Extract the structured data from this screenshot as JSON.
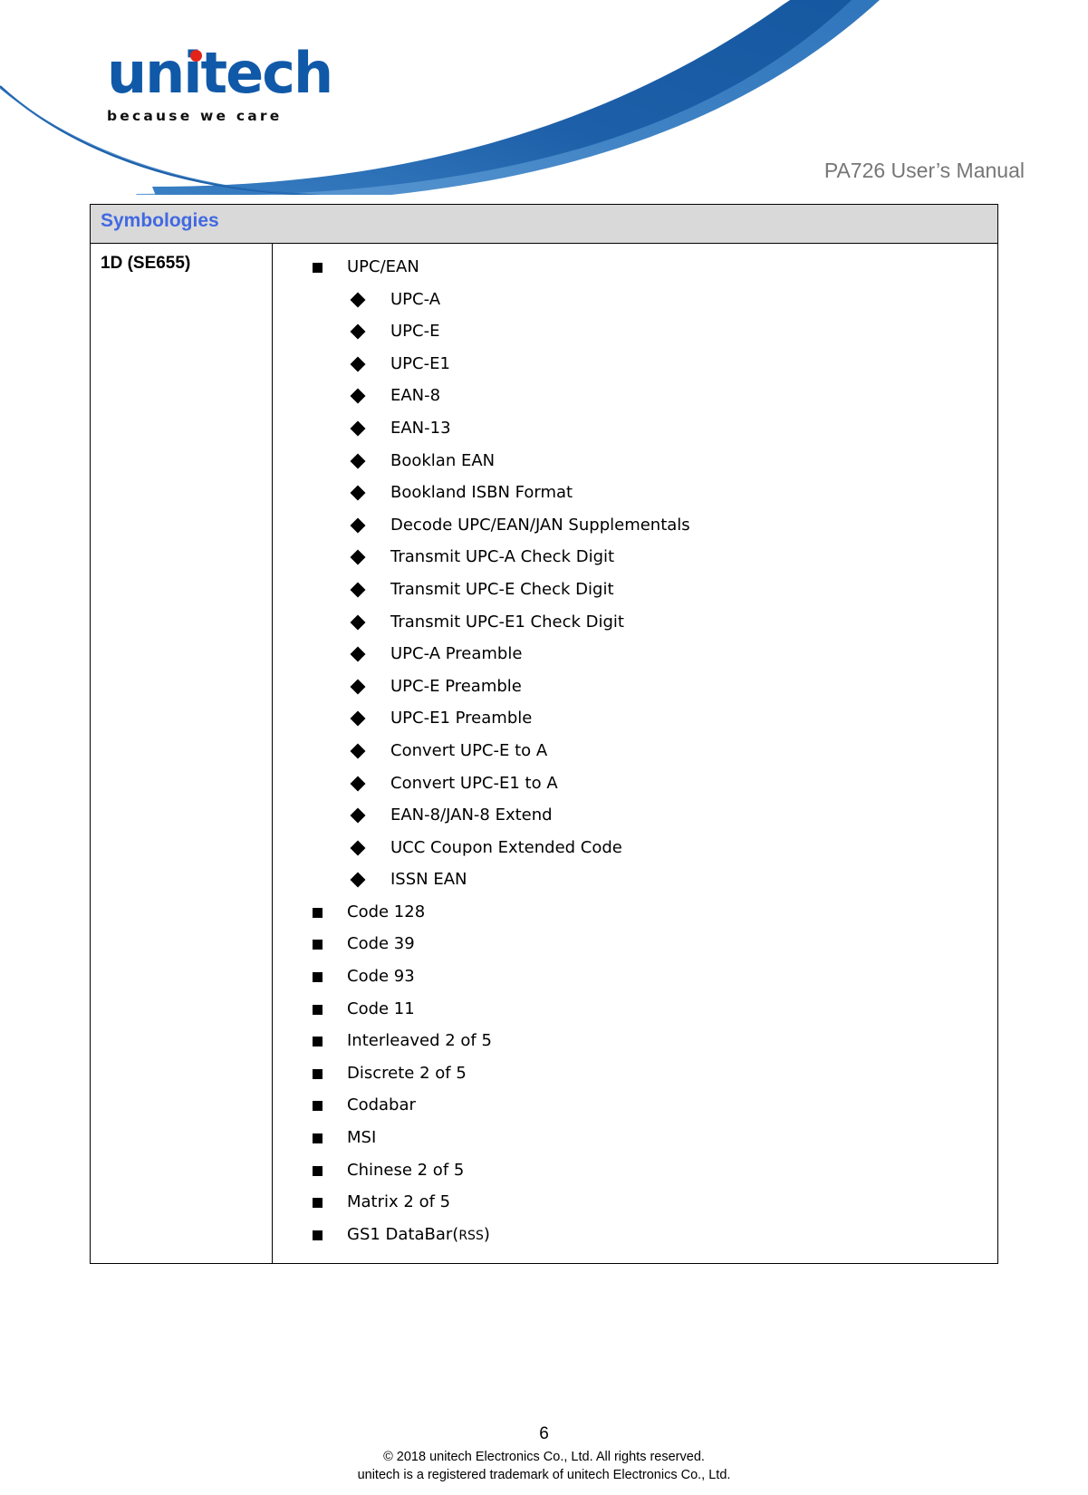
{
  "header": {
    "logo_wordmark": "unitech",
    "logo_tagline": "because we care",
    "manual_title": "PA726 User’s Manual",
    "brand_blue": "#1059a8",
    "logo_dot_red": "#e2231a",
    "swoosh_dark_blue": "#1d5fa8",
    "swoosh_mid_blue": "#2c74bc",
    "swoosh_light_blue": "#4d8fcf"
  },
  "table": {
    "section_header": "Symbologies",
    "section_header_color": "#4169e1",
    "section_header_bg": "#d9d9d9",
    "row_label": "1D (SE655)",
    "items": [
      {
        "level": 1,
        "text": "UPC/EAN"
      },
      {
        "level": 2,
        "text": "UPC-A"
      },
      {
        "level": 2,
        "text": "UPC-E"
      },
      {
        "level": 2,
        "text": "UPC-E1"
      },
      {
        "level": 2,
        "text": "EAN-8"
      },
      {
        "level": 2,
        "text": "EAN-13"
      },
      {
        "level": 2,
        "text": "Booklan EAN"
      },
      {
        "level": 2,
        "text": "Bookland ISBN Format"
      },
      {
        "level": 2,
        "text": "Decode UPC/EAN/JAN Supplementals"
      },
      {
        "level": 2,
        "text": "Transmit UPC-A Check Digit"
      },
      {
        "level": 2,
        "text": "Transmit UPC-E Check Digit"
      },
      {
        "level": 2,
        "text": "Transmit UPC-E1 Check Digit"
      },
      {
        "level": 2,
        "text": "UPC-A Preamble"
      },
      {
        "level": 2,
        "text": "UPC-E Preamble"
      },
      {
        "level": 2,
        "text": "UPC-E1 Preamble"
      },
      {
        "level": 2,
        "text": "Convert UPC-E to A"
      },
      {
        "level": 2,
        "text": "Convert UPC-E1 to A"
      },
      {
        "level": 2,
        "text": "EAN-8/JAN-8 Extend"
      },
      {
        "level": 2,
        "text": "UCC Coupon Extended Code"
      },
      {
        "level": 2,
        "text": "ISSN EAN"
      },
      {
        "level": 1,
        "text": "Code 128"
      },
      {
        "level": 1,
        "text": "Code 39"
      },
      {
        "level": 1,
        "text": "Code 93"
      },
      {
        "level": 1,
        "text": "Code 11"
      },
      {
        "level": 1,
        "text": "Interleaved 2 of 5"
      },
      {
        "level": 1,
        "text": "Discrete 2 of 5"
      },
      {
        "level": 1,
        "text": "Codabar"
      },
      {
        "level": 1,
        "text": "MSI"
      },
      {
        "level": 1,
        "text": "Chinese 2 of 5"
      },
      {
        "level": 1,
        "text": "Matrix 2 of 5"
      },
      {
        "level": 1,
        "text": "GS1 DataBar(",
        "suffix_small": "RSS",
        "text_tail": ")"
      }
    ]
  },
  "footer": {
    "page_number": "6",
    "copyright_line": "© 2018 unitech Electronics Co., Ltd. All rights reserved.",
    "trademark_line": "unitech is a registered trademark of unitech Electronics Co., Ltd."
  }
}
